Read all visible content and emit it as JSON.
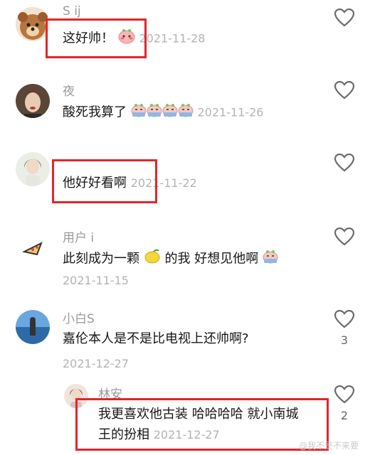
{
  "comments": [
    {
      "name": "S       ij",
      "text": "这好帅！",
      "date": "2021-11-28"
    },
    {
      "name": "夜",
      "text": "酸死我算了",
      "date": "2021-11-26"
    },
    {
      "name": "",
      "text": "他好好看啊",
      "date": "2021-11-22"
    },
    {
      "name": "用户        i",
      "text_part1": "此刻成为一颗",
      "text_part2": "的我  好想见他啊",
      "date": "2021-11-15"
    },
    {
      "name": "小白S",
      "text": "嘉伦本人是不是比电视上还帅啊?",
      "date": "2021-12-27",
      "likes": "3"
    },
    {
      "name": "林安",
      "text_line1": "我更喜欢他古装 哈哈哈哈 就小南城",
      "text_line2": "王的扮相",
      "date": "2021-12-27",
      "likes": "2"
    }
  ],
  "watermark": "@我不是不来要",
  "colors": {
    "highlight": "#e0262b",
    "date": "#b3b3b3",
    "name": "#9a9a9a"
  }
}
